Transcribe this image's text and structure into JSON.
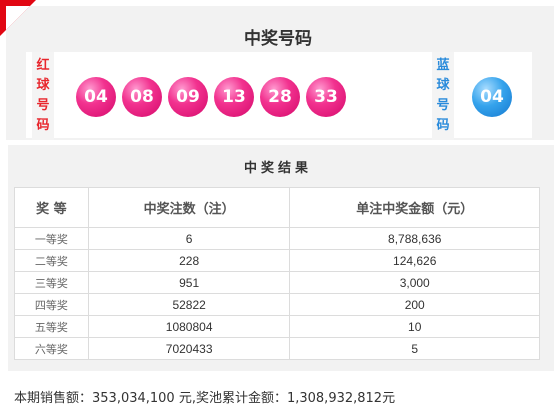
{
  "header": {
    "title": "中奖号码"
  },
  "red_tag": {
    "chars": [
      "红",
      "球",
      "号",
      "码"
    ]
  },
  "blue_tag": {
    "chars": [
      "蓝",
      "球",
      "号",
      "码"
    ]
  },
  "red_balls": [
    "04",
    "08",
    "09",
    "13",
    "28",
    "33"
  ],
  "blue_ball": "04",
  "colors": {
    "accent": "#e10612",
    "red_ball": "#f2328f",
    "blue_ball": "#35a3ec",
    "red_text": "#e8262d",
    "blue_text": "#2a8bdb"
  },
  "results": {
    "title": "中奖结果",
    "headers": [
      "奖 等",
      "中奖注数（注）",
      "单注中奖金额（元）"
    ],
    "rows": [
      [
        "一等奖",
        "6",
        "8,788,636"
      ],
      [
        "二等奖",
        "228",
        "124,626"
      ],
      [
        "三等奖",
        "951",
        "3,000"
      ],
      [
        "四等奖",
        "52822",
        "200"
      ],
      [
        "五等奖",
        "1080804",
        "10"
      ],
      [
        "六等奖",
        "7020433",
        "5"
      ]
    ]
  },
  "footer": {
    "text": "本期销售额：353,034,100 元,奖池累计金额：1,308,932,812元"
  }
}
